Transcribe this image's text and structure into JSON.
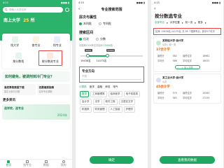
{
  "status": {
    "time": "4:15",
    "sig": "●●● ▮"
  },
  "p1": {
    "search_placeholder": "请输入大学名称",
    "university_name": "南上大学",
    "university_count": "25",
    "university_count_suffix": "所",
    "sub_caption": "...",
    "entry1": "找大学",
    "entry2": "查专业",
    "entry3": "找专业",
    "entry4": "按分数找",
    "entry5": "按分数选专业",
    "question": "如何避免，被调剂到冷门专业？",
    "card1_title": "高校录取数据下载",
    "card1_sub": "招生计划与分数",
    "card2_title": "志愿填报指南",
    "card2_sub": "往年专业录取",
    "more_header": "更多资讯",
    "banner_text": "选学校，选专业",
    "banner_num": "2024年",
    "nav": [
      "首页",
      "找专业",
      "数据",
      "我的"
    ]
  },
  "p2": {
    "title": "专业搜索范围",
    "section1": "层次与属性",
    "opt_benke": "本科批",
    "opt_zhuanke": "专科批",
    "section2": "搜索区间",
    "opt_a": "位次",
    "opt_b": "分数",
    "hint": "请选择2024年位次区间",
    "hint_range": "15000名",
    "slider_low": "5000",
    "slider_high": "22000",
    "range_low": "19438名",
    "range_high": "14175名",
    "section3": "专业方向",
    "input_placeholder": "不限",
    "tabs": [
      "计算机",
      "医学",
      "金融",
      "师范",
      "电气"
    ],
    "chips": [
      "数学",
      "工商管理类",
      "临床医学",
      "电子信息类",
      "会计学",
      "法学",
      "软件工程",
      "汉语言文学",
      "机械类",
      "财务管理",
      "人工智能",
      "护理学"
    ],
    "confirm_button": "确定"
  },
  "p3": {
    "title": "按分数选专业",
    "filters": [
      "全部专业",
      "大学位置",
      "双一流",
      "更多"
    ],
    "summary": "区间: 19438名-14175名, 共 99 个推荐专业，其中5个可冲",
    "school1": "某财经大学·会计学",
    "school1_tag": "公办 | 双一流",
    "major1": "37会计学",
    "rows1": [
      [
        "最低分",
        "582",
        "最低位次",
        "18962"
      ],
      [
        "平均分",
        "586",
        "平均位次",
        "16032"
      ]
    ],
    "school2": "某工业大学·会计学",
    "school2_tag": "公办",
    "major2": "45会计学",
    "rows2": [
      [
        "最低分",
        "579",
        "最低位次",
        "19260"
      ],
      [
        "平均分",
        "583",
        "平均位次",
        "17235"
      ]
    ],
    "add_button": "+ 加入志愿",
    "view_button": "查看我的数据",
    "brand_color": "#1fa862"
  }
}
